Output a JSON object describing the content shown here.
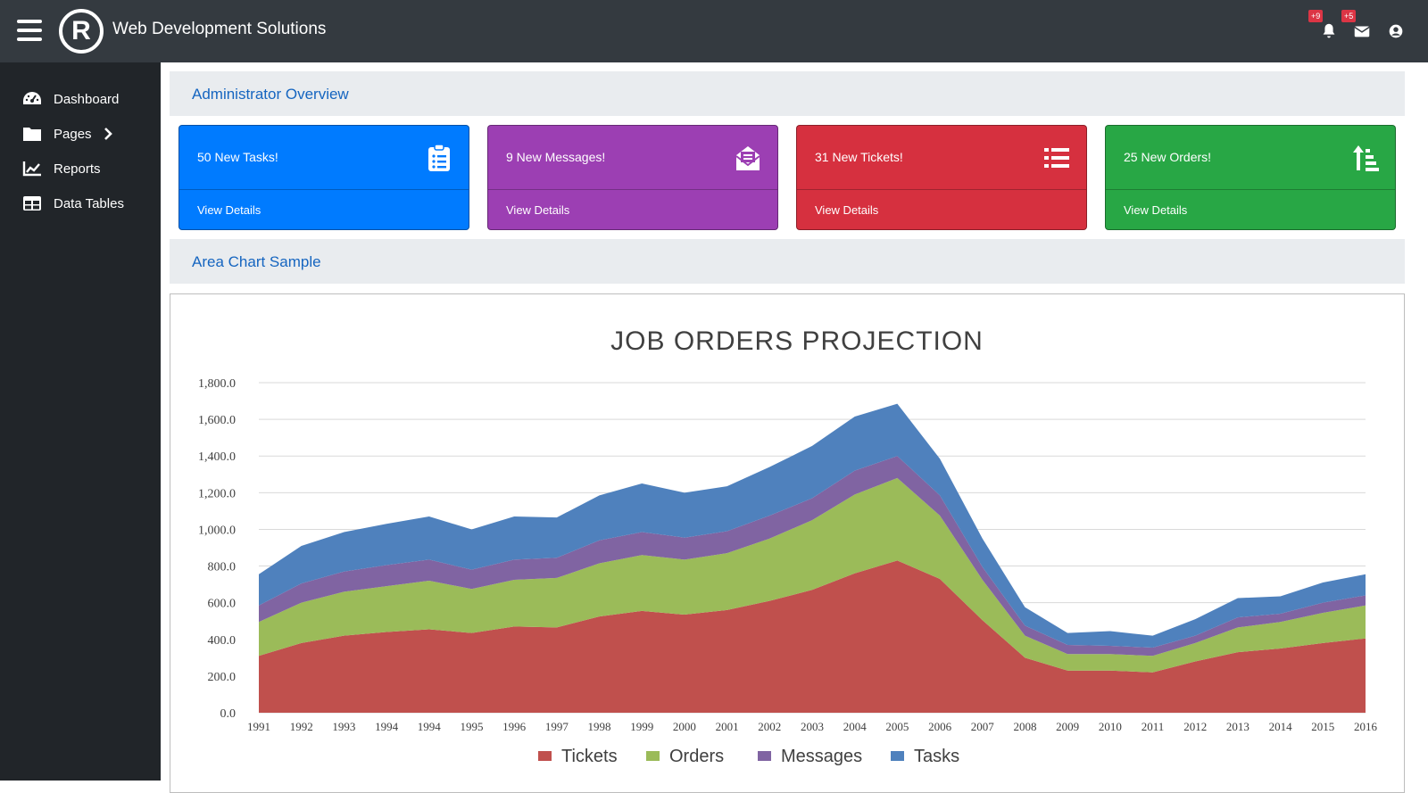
{
  "header": {
    "brand": "Web Development Solutions",
    "logo_letter": "R",
    "notifications_badge": "+9",
    "messages_badge": "+5"
  },
  "sidebar": {
    "items": [
      {
        "label": "Dashboard",
        "icon": "dashboard-icon"
      },
      {
        "label": "Pages",
        "icon": "folder-icon"
      },
      {
        "label": "Reports",
        "icon": "chart-line-icon"
      },
      {
        "label": "Data Tables",
        "icon": "table-icon"
      }
    ]
  },
  "overview": {
    "title": "Administrator Overview"
  },
  "cards": [
    {
      "title": "50 New Tasks!",
      "details": "View Details",
      "color": "#007bff",
      "icon": "clipboard-list-icon"
    },
    {
      "title": "9 New Messages!",
      "details": "View Details",
      "color": "#9c3fb3",
      "icon": "envelope-open-icon"
    },
    {
      "title": "31 New Tickets!",
      "details": "View Details",
      "color": "#d6303f",
      "icon": "list-icon"
    },
    {
      "title": "25 New Orders!",
      "details": "View Details",
      "color": "#28a745",
      "icon": "sort-amount-up-icon"
    }
  ],
  "area_chart": {
    "section_title": "Area Chart Sample"
  },
  "chart_data": {
    "type": "area",
    "stacked": true,
    "title": "JOB ORDERS PROJECTION",
    "xlabel": "",
    "ylabel": "",
    "ylim": [
      0,
      1800
    ],
    "y_ticks": [
      "0.0",
      "200.0",
      "400.0",
      "600.0",
      "800.0",
      "1,000.0",
      "1,200.0",
      "1,400.0",
      "1,600.0",
      "1,800.0"
    ],
    "grid": true,
    "legend_position": "bottom",
    "categories": [
      "1991",
      "1992",
      "1993",
      "1994",
      "1994",
      "1995",
      "1996",
      "1997",
      "1998",
      "1999",
      "2000",
      "2001",
      "2002",
      "2003",
      "2004",
      "2005",
      "2006",
      "2007",
      "2008",
      "2009",
      "2010",
      "2011",
      "2012",
      "2013",
      "2014",
      "2015",
      "2016"
    ],
    "series": [
      {
        "name": "Tickets",
        "color": "#c0504d",
        "values": [
          310,
          380,
          420,
          440,
          455,
          435,
          470,
          465,
          525,
          555,
          535,
          560,
          610,
          670,
          760,
          830,
          730,
          505,
          300,
          230,
          230,
          220,
          280,
          330,
          350,
          380,
          405
        ]
      },
      {
        "name": "Orders",
        "color": "#9bbb59",
        "values": [
          185,
          220,
          240,
          250,
          265,
          240,
          255,
          270,
          290,
          305,
          300,
          310,
          340,
          380,
          430,
          450,
          345,
          220,
          120,
          90,
          90,
          90,
          100,
          135,
          145,
          165,
          180
        ]
      },
      {
        "name": "Messages",
        "color": "#8064a2",
        "values": [
          90,
          105,
          110,
          115,
          115,
          105,
          110,
          110,
          125,
          125,
          120,
          120,
          125,
          120,
          130,
          120,
          110,
          70,
          55,
          50,
          45,
          45,
          40,
          55,
          45,
          55,
          55
        ]
      },
      {
        "name": "Tasks",
        "color": "#4f81bd",
        "values": [
          170,
          205,
          215,
          225,
          235,
          220,
          235,
          220,
          245,
          265,
          245,
          245,
          265,
          285,
          295,
          285,
          200,
          155,
          100,
          65,
          80,
          65,
          90,
          105,
          95,
          110,
          115
        ]
      }
    ]
  }
}
